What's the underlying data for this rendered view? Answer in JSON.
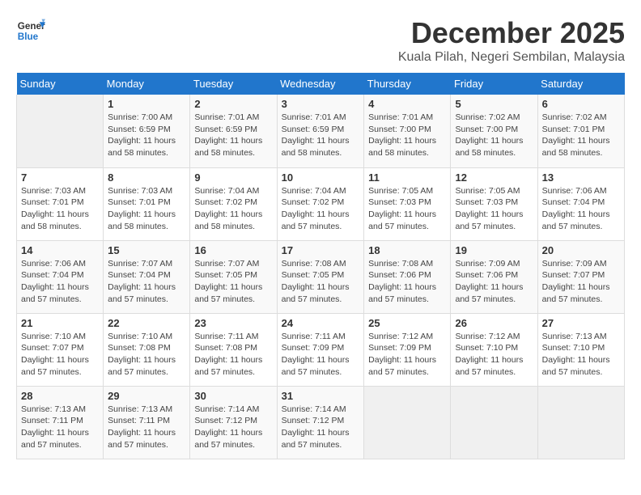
{
  "logo": {
    "line1": "General",
    "line2": "Blue"
  },
  "title": "December 2025",
  "location": "Kuala Pilah, Negeri Sembilan, Malaysia",
  "days_of_week": [
    "Sunday",
    "Monday",
    "Tuesday",
    "Wednesday",
    "Thursday",
    "Friday",
    "Saturday"
  ],
  "weeks": [
    [
      {
        "day": "",
        "info": ""
      },
      {
        "day": "1",
        "info": "Sunrise: 7:00 AM\nSunset: 6:59 PM\nDaylight: 11 hours\nand 58 minutes."
      },
      {
        "day": "2",
        "info": "Sunrise: 7:01 AM\nSunset: 6:59 PM\nDaylight: 11 hours\nand 58 minutes."
      },
      {
        "day": "3",
        "info": "Sunrise: 7:01 AM\nSunset: 6:59 PM\nDaylight: 11 hours\nand 58 minutes."
      },
      {
        "day": "4",
        "info": "Sunrise: 7:01 AM\nSunset: 7:00 PM\nDaylight: 11 hours\nand 58 minutes."
      },
      {
        "day": "5",
        "info": "Sunrise: 7:02 AM\nSunset: 7:00 PM\nDaylight: 11 hours\nand 58 minutes."
      },
      {
        "day": "6",
        "info": "Sunrise: 7:02 AM\nSunset: 7:01 PM\nDaylight: 11 hours\nand 58 minutes."
      }
    ],
    [
      {
        "day": "7",
        "info": "Sunrise: 7:03 AM\nSunset: 7:01 PM\nDaylight: 11 hours\nand 58 minutes."
      },
      {
        "day": "8",
        "info": "Sunrise: 7:03 AM\nSunset: 7:01 PM\nDaylight: 11 hours\nand 58 minutes."
      },
      {
        "day": "9",
        "info": "Sunrise: 7:04 AM\nSunset: 7:02 PM\nDaylight: 11 hours\nand 58 minutes."
      },
      {
        "day": "10",
        "info": "Sunrise: 7:04 AM\nSunset: 7:02 PM\nDaylight: 11 hours\nand 57 minutes."
      },
      {
        "day": "11",
        "info": "Sunrise: 7:05 AM\nSunset: 7:03 PM\nDaylight: 11 hours\nand 57 minutes."
      },
      {
        "day": "12",
        "info": "Sunrise: 7:05 AM\nSunset: 7:03 PM\nDaylight: 11 hours\nand 57 minutes."
      },
      {
        "day": "13",
        "info": "Sunrise: 7:06 AM\nSunset: 7:04 PM\nDaylight: 11 hours\nand 57 minutes."
      }
    ],
    [
      {
        "day": "14",
        "info": "Sunrise: 7:06 AM\nSunset: 7:04 PM\nDaylight: 11 hours\nand 57 minutes."
      },
      {
        "day": "15",
        "info": "Sunrise: 7:07 AM\nSunset: 7:04 PM\nDaylight: 11 hours\nand 57 minutes."
      },
      {
        "day": "16",
        "info": "Sunrise: 7:07 AM\nSunset: 7:05 PM\nDaylight: 11 hours\nand 57 minutes."
      },
      {
        "day": "17",
        "info": "Sunrise: 7:08 AM\nSunset: 7:05 PM\nDaylight: 11 hours\nand 57 minutes."
      },
      {
        "day": "18",
        "info": "Sunrise: 7:08 AM\nSunset: 7:06 PM\nDaylight: 11 hours\nand 57 minutes."
      },
      {
        "day": "19",
        "info": "Sunrise: 7:09 AM\nSunset: 7:06 PM\nDaylight: 11 hours\nand 57 minutes."
      },
      {
        "day": "20",
        "info": "Sunrise: 7:09 AM\nSunset: 7:07 PM\nDaylight: 11 hours\nand 57 minutes."
      }
    ],
    [
      {
        "day": "21",
        "info": "Sunrise: 7:10 AM\nSunset: 7:07 PM\nDaylight: 11 hours\nand 57 minutes."
      },
      {
        "day": "22",
        "info": "Sunrise: 7:10 AM\nSunset: 7:08 PM\nDaylight: 11 hours\nand 57 minutes."
      },
      {
        "day": "23",
        "info": "Sunrise: 7:11 AM\nSunset: 7:08 PM\nDaylight: 11 hours\nand 57 minutes."
      },
      {
        "day": "24",
        "info": "Sunrise: 7:11 AM\nSunset: 7:09 PM\nDaylight: 11 hours\nand 57 minutes."
      },
      {
        "day": "25",
        "info": "Sunrise: 7:12 AM\nSunset: 7:09 PM\nDaylight: 11 hours\nand 57 minutes."
      },
      {
        "day": "26",
        "info": "Sunrise: 7:12 AM\nSunset: 7:10 PM\nDaylight: 11 hours\nand 57 minutes."
      },
      {
        "day": "27",
        "info": "Sunrise: 7:13 AM\nSunset: 7:10 PM\nDaylight: 11 hours\nand 57 minutes."
      }
    ],
    [
      {
        "day": "28",
        "info": "Sunrise: 7:13 AM\nSunset: 7:11 PM\nDaylight: 11 hours\nand 57 minutes."
      },
      {
        "day": "29",
        "info": "Sunrise: 7:13 AM\nSunset: 7:11 PM\nDaylight: 11 hours\nand 57 minutes."
      },
      {
        "day": "30",
        "info": "Sunrise: 7:14 AM\nSunset: 7:12 PM\nDaylight: 11 hours\nand 57 minutes."
      },
      {
        "day": "31",
        "info": "Sunrise: 7:14 AM\nSunset: 7:12 PM\nDaylight: 11 hours\nand 57 minutes."
      },
      {
        "day": "",
        "info": ""
      },
      {
        "day": "",
        "info": ""
      },
      {
        "day": "",
        "info": ""
      }
    ]
  ]
}
